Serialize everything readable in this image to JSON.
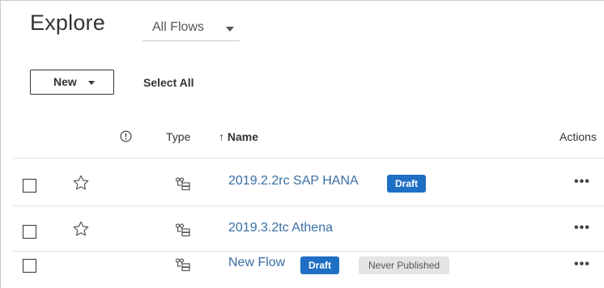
{
  "header": {
    "title": "Explore",
    "filter_label": "All Flows"
  },
  "toolbar": {
    "new_label": "New",
    "select_all_label": "Select All"
  },
  "table": {
    "columns": {
      "type": "Type",
      "name": "↑ Name",
      "actions": "Actions"
    },
    "rows": [
      {
        "name": "2019.2.2rc SAP HANA",
        "badges": [
          "Draft"
        ],
        "favorite": true,
        "actions": "•••"
      },
      {
        "name": "2019.3.2tc Athena",
        "badges": [],
        "favorite": true,
        "actions": "•••"
      },
      {
        "name": "New Flow",
        "badges": [
          "Draft",
          "Never Published"
        ],
        "favorite": false,
        "actions": "•••"
      }
    ]
  },
  "colors": {
    "link": "#3a6ea5",
    "draft_badge": "#1f6fc5",
    "never_badge_bg": "#e4e4e4"
  },
  "icons": [
    "alert-circle-icon",
    "star-outline-icon",
    "flow-icon",
    "chevron-down-icon"
  ]
}
